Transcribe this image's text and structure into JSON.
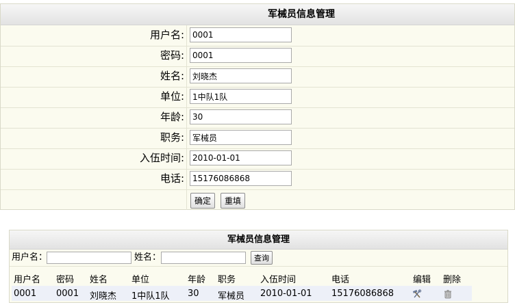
{
  "form": {
    "title": "军械员信息管理",
    "fields": [
      {
        "label": "用户名:",
        "value": "0001"
      },
      {
        "label": "密码:",
        "value": "0001"
      },
      {
        "label": "姓名:",
        "value": "刘晓杰"
      },
      {
        "label": "单位:",
        "value": "1中队1队"
      },
      {
        "label": "年龄:",
        "value": "30"
      },
      {
        "label": "职务:",
        "value": "军械员"
      },
      {
        "label": "入伍时间:",
        "value": "2010-01-01"
      },
      {
        "label": "电话:",
        "value": "15176086868"
      }
    ],
    "confirm_label": "确定",
    "reset_label": "重填"
  },
  "list": {
    "title": "军械员信息管理",
    "search": {
      "username_label": "用户名：",
      "username_value": "",
      "name_label": "姓名：",
      "name_value": "",
      "query_label": "查询"
    },
    "columns": [
      "用户名",
      "密码",
      "姓名",
      "单位",
      "年龄",
      "职务",
      "入伍时间",
      "电话",
      "编辑",
      "删除"
    ],
    "rows": [
      [
        "0001",
        "0001",
        "刘晓杰",
        "1中队1队",
        "30",
        "军械员",
        "2010-01-01",
        "15176086868"
      ]
    ]
  },
  "icons": {
    "edit": "edit-tools-icon",
    "delete": "trash-icon"
  }
}
